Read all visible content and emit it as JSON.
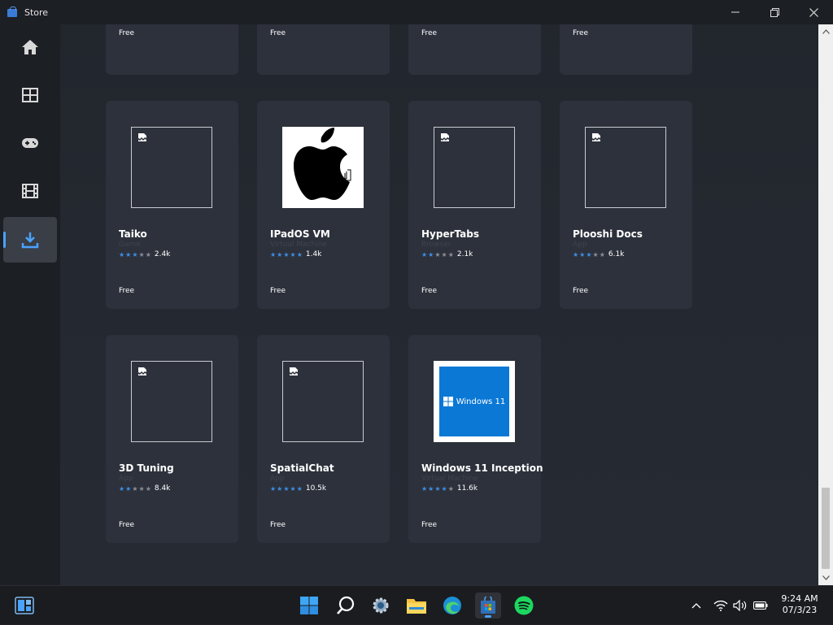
{
  "window": {
    "title": "Store"
  },
  "sidebar": {
    "items": [
      {
        "icon": "home-icon",
        "active": false
      },
      {
        "icon": "apps-grid-icon",
        "active": false
      },
      {
        "icon": "gamepad-icon",
        "active": false
      },
      {
        "icon": "film-icon",
        "active": false
      },
      {
        "icon": "download-icon",
        "active": true
      }
    ]
  },
  "top_row_prices": [
    "Free",
    "Free",
    "Free",
    "Free"
  ],
  "apps": [
    {
      "name": "Taiko",
      "category": "Game",
      "stars": 3,
      "rating_count": "2.4k",
      "price": "Free",
      "thumb": "broken"
    },
    {
      "name": "IPadOS VM",
      "category": "Virtual Machine",
      "stars": 5,
      "rating_count": "1.4k",
      "price": "Free",
      "thumb": "apple-logo"
    },
    {
      "name": "HyperTabs",
      "category": "Browser",
      "stars": 2,
      "rating_count": "2.1k",
      "price": "Free",
      "thumb": "broken"
    },
    {
      "name": "Plooshi Docs",
      "category": "App",
      "stars": 3,
      "rating_count": "6.1k",
      "price": "Free",
      "thumb": "broken"
    },
    {
      "name": "3D Tuning",
      "category": "App",
      "stars": 2,
      "rating_count": "8.4k",
      "price": "Free",
      "thumb": "broken"
    },
    {
      "name": "SpatialChat",
      "category": "App",
      "stars": 5,
      "rating_count": "10.5k",
      "price": "Free",
      "thumb": "broken"
    },
    {
      "name": "Windows 11 Inception",
      "category": "Virtual Machine",
      "stars": 4,
      "rating_count": "11.6k",
      "price": "Free",
      "thumb": "windows11-logo"
    }
  ],
  "windows11_logo_text": "Windows 11",
  "taskbar": {
    "icons": [
      "widgets-icon",
      "start-icon",
      "search-icon",
      "settings-icon",
      "file-explorer-icon",
      "edge-icon",
      "store-icon",
      "spotify-icon"
    ],
    "clock_time": "9:24 AM",
    "clock_date": "07/3/23"
  },
  "colors": {
    "accent": "#4aa3ff",
    "star": "#3d8ee6",
    "card": "#2d313b"
  }
}
